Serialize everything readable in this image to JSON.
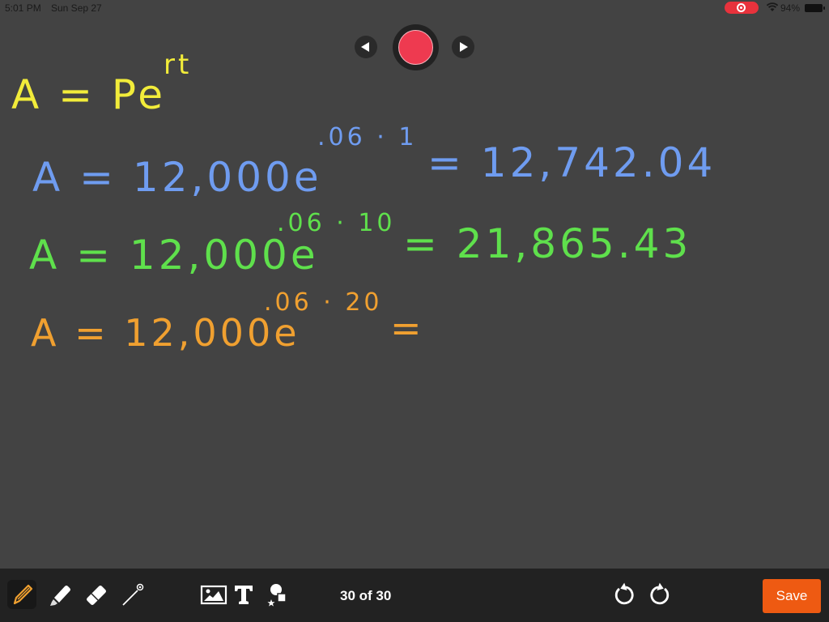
{
  "status_bar": {
    "time": "5:01 PM",
    "date": "Sun Sep 27",
    "recording_indicator": "screen-record-icon",
    "wifi": "wifi-icon",
    "battery_percent": "94%",
    "battery_icon": "battery-icon"
  },
  "playback": {
    "prev_icon": "triangle-left-icon",
    "record_icon": "record-dot-icon",
    "next_icon": "triangle-right-icon"
  },
  "whiteboard": {
    "lines": [
      {
        "color": "#f2ec3a",
        "base": "A = Pe",
        "exponent": "rt",
        "result": ""
      },
      {
        "color": "#6f9cf0",
        "base": "A = 12,000e",
        "exponent": ".06 · 1",
        "result": "= 12,742.04"
      },
      {
        "color": "#5fe04c",
        "base": "A = 12,000e",
        "exponent": ".06 · 10",
        "result": "= 21,865.43"
      },
      {
        "color": "#f0a030",
        "base": "A = 12,000e",
        "exponent": ".06 · 20",
        "result": "="
      }
    ]
  },
  "toolbar": {
    "tools": [
      {
        "name": "pencil",
        "icon": "pencil-icon",
        "active": true,
        "color": "#f0a030"
      },
      {
        "name": "highlighter",
        "icon": "highlighter-icon",
        "active": false
      },
      {
        "name": "eraser",
        "icon": "eraser-icon",
        "active": false
      },
      {
        "name": "laser-pointer",
        "icon": "laser-pointer-icon",
        "active": false
      },
      {
        "name": "insert-image",
        "icon": "image-icon",
        "active": false
      },
      {
        "name": "text",
        "icon": "text-icon",
        "active": false
      },
      {
        "name": "shapes",
        "icon": "shapes-icon",
        "active": false
      }
    ],
    "page_indicator": "30 of 30",
    "undo_icon": "undo-icon",
    "redo_icon": "redo-icon",
    "save_label": "Save",
    "save_color": "#ee5a12"
  }
}
